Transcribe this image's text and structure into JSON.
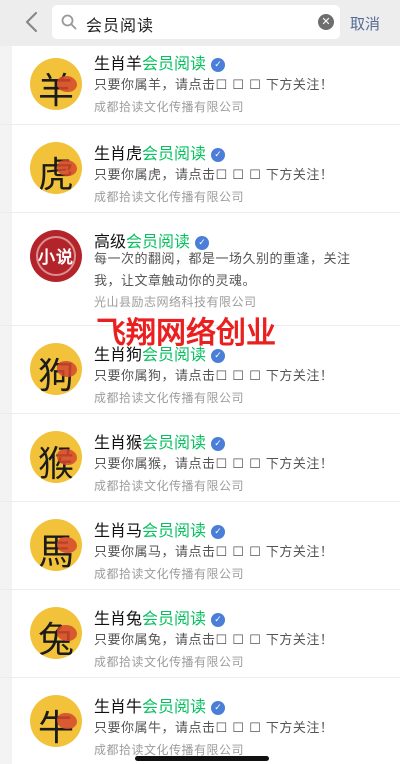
{
  "search": {
    "query": "会员阅读",
    "cancel_label": "取消"
  },
  "results": [
    {
      "prefix": "生肖羊",
      "highlight": "会员阅读",
      "avatar_glyph": "羊",
      "description": "只要你属羊，请点击☐ ☐ ☐ 下方关注！",
      "company": "成都拾读文化传播有限公司"
    },
    {
      "prefix": "生肖虎",
      "highlight": "会员阅读",
      "avatar_glyph": "虎",
      "description": "只要你属虎，请点击☐ ☐ ☐ 下方关注！",
      "company": "成都拾读文化传播有限公司"
    },
    {
      "prefix": "高级",
      "highlight": "会员阅读",
      "avatar_glyph": "小说",
      "description": "每一次的翻阅，都是一场久别的重逢，关注我，让文章触动你的灵魂。",
      "company": "光山县励志网络科技有限公司"
    },
    {
      "prefix": "生肖狗",
      "highlight": "会员阅读",
      "avatar_glyph": "狗",
      "description": "只要你属狗，请点击☐ ☐ ☐ 下方关注！",
      "company": "成都拾读文化传播有限公司"
    },
    {
      "prefix": "生肖猴",
      "highlight": "会员阅读",
      "avatar_glyph": "猴",
      "description": "只要你属猴，请点击☐ ☐ ☐ 下方关注！",
      "company": "成都拾读文化传播有限公司"
    },
    {
      "prefix": "生肖马",
      "highlight": "会员阅读",
      "avatar_glyph": "馬",
      "description": "只要你属马，请点击☐ ☐ ☐ 下方关注！",
      "company": "成都拾读文化传播有限公司"
    },
    {
      "prefix": "生肖兔",
      "highlight": "会员阅读",
      "avatar_glyph": "兔",
      "description": "只要你属兔，请点击☐ ☐ ☐ 下方关注！",
      "company": "成都拾读文化传播有限公司"
    },
    {
      "prefix": "生肖牛",
      "highlight": "会员阅读",
      "avatar_glyph": "牛",
      "description": "只要你属牛，请点击☐ ☐ ☐ 下方关注！",
      "company": "成都拾读文化传播有限公司"
    }
  ],
  "watermark": "飞翔网络创业",
  "colors": {
    "highlight": "#07c160",
    "cancel": "#576b95",
    "verified": "#4a7ed8",
    "watermark": "#ea1f1f"
  }
}
